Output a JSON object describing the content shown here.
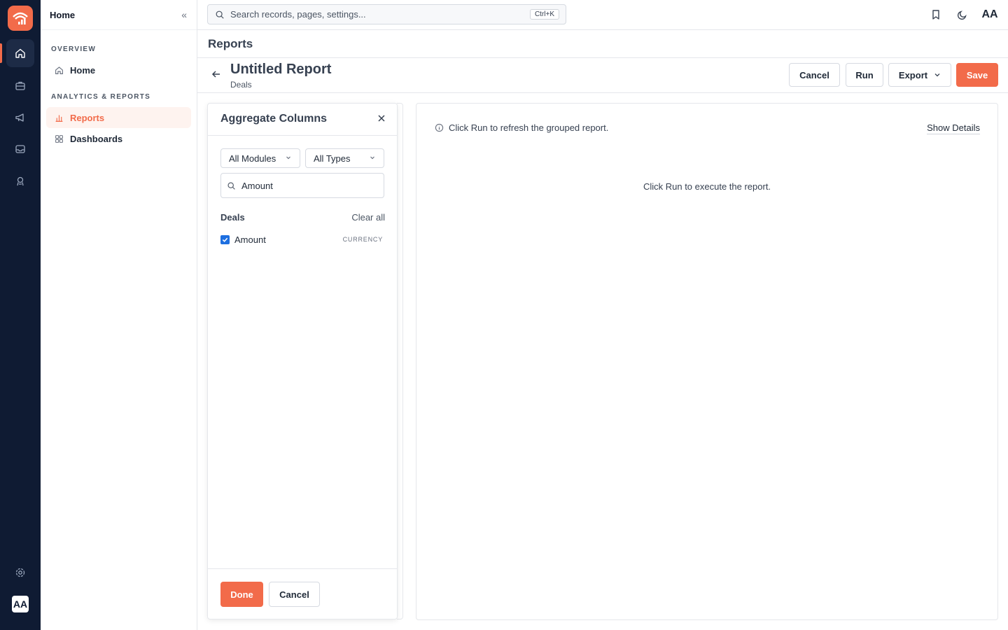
{
  "nav": {
    "title": "Home",
    "sections": [
      {
        "label": "OVERVIEW",
        "items": [
          {
            "label": "Home",
            "icon": "home-icon"
          }
        ]
      },
      {
        "label": "ANALYTICS & REPORTS",
        "items": [
          {
            "label": "Reports",
            "icon": "bar-chart-icon"
          },
          {
            "label": "Dashboards",
            "icon": "grid-icon"
          }
        ]
      }
    ]
  },
  "rail": {
    "avatar": "AA"
  },
  "topbar": {
    "search_placeholder": "Search records, pages, settings...",
    "shortcut": "Ctrl+K",
    "avatar": "AA"
  },
  "page": {
    "title": "Reports"
  },
  "report": {
    "title": "Untitled Report",
    "module": "Deals",
    "actions": {
      "cancel": "Cancel",
      "run": "Run",
      "export": "Export",
      "save": "Save"
    }
  },
  "aggregate_panel": {
    "title": "Aggregate Columns",
    "module_filter": "All Modules",
    "type_filter": "All Types",
    "search_value": "Amount",
    "group_label": "Deals",
    "clear_all": "Clear all",
    "columns": [
      {
        "label": "Amount",
        "type": "CURRENCY",
        "checked": true
      }
    ],
    "done": "Done",
    "cancel": "Cancel"
  },
  "results": {
    "info": "Click Run to refresh the grouped report.",
    "show_details": "Show Details",
    "empty": "Click Run to execute the report."
  },
  "colors": {
    "accent": "#f26b4a",
    "rail_bg": "#0f1b33",
    "checkbox": "#1d6fe0"
  }
}
